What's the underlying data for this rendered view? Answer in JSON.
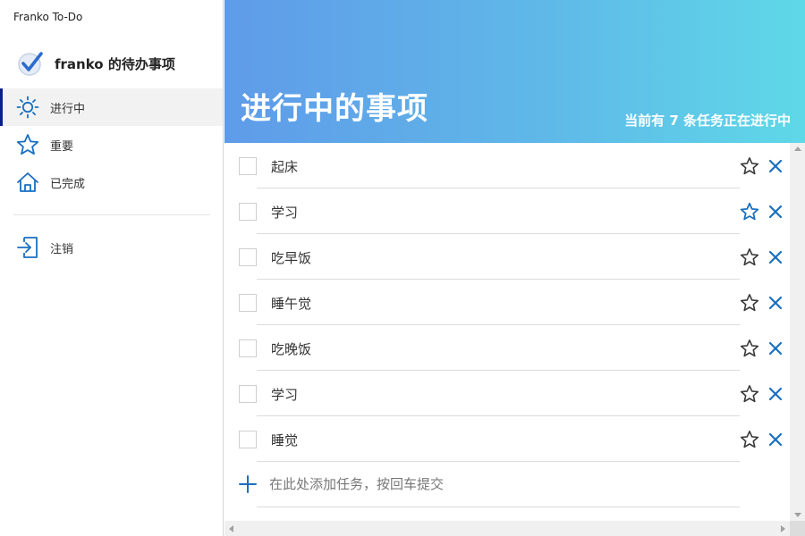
{
  "window": {
    "title": "Franko To-Do"
  },
  "user": {
    "name": "franko 的待办事项",
    "logo_icon": "check-circle-icon"
  },
  "colors": {
    "accent": "#1a6fc0",
    "active_marker": "#0a1e8c",
    "header_start": "#5f9be9",
    "header_end": "#5fd8e8"
  },
  "sidebar": {
    "items": [
      {
        "label": "进行中",
        "icon": "sun-icon",
        "active": true
      },
      {
        "label": "重要",
        "icon": "star-icon",
        "active": false
      },
      {
        "label": "已完成",
        "icon": "home-icon",
        "active": false
      }
    ],
    "logout": {
      "label": "注销",
      "icon": "logout-icon"
    }
  },
  "header": {
    "title": "进行中的事项",
    "count_text": "当前有 7 条任务正在进行中"
  },
  "tasks": [
    {
      "text": "起床",
      "important": false
    },
    {
      "text": "学习",
      "important": true
    },
    {
      "text": "吃早饭",
      "important": false
    },
    {
      "text": "睡午觉",
      "important": false
    },
    {
      "text": "吃晚饭",
      "important": false
    },
    {
      "text": "学习",
      "important": false
    },
    {
      "text": "睡觉",
      "important": false
    }
  ],
  "add_task": {
    "placeholder": "在此处添加任务，按回车提交"
  }
}
